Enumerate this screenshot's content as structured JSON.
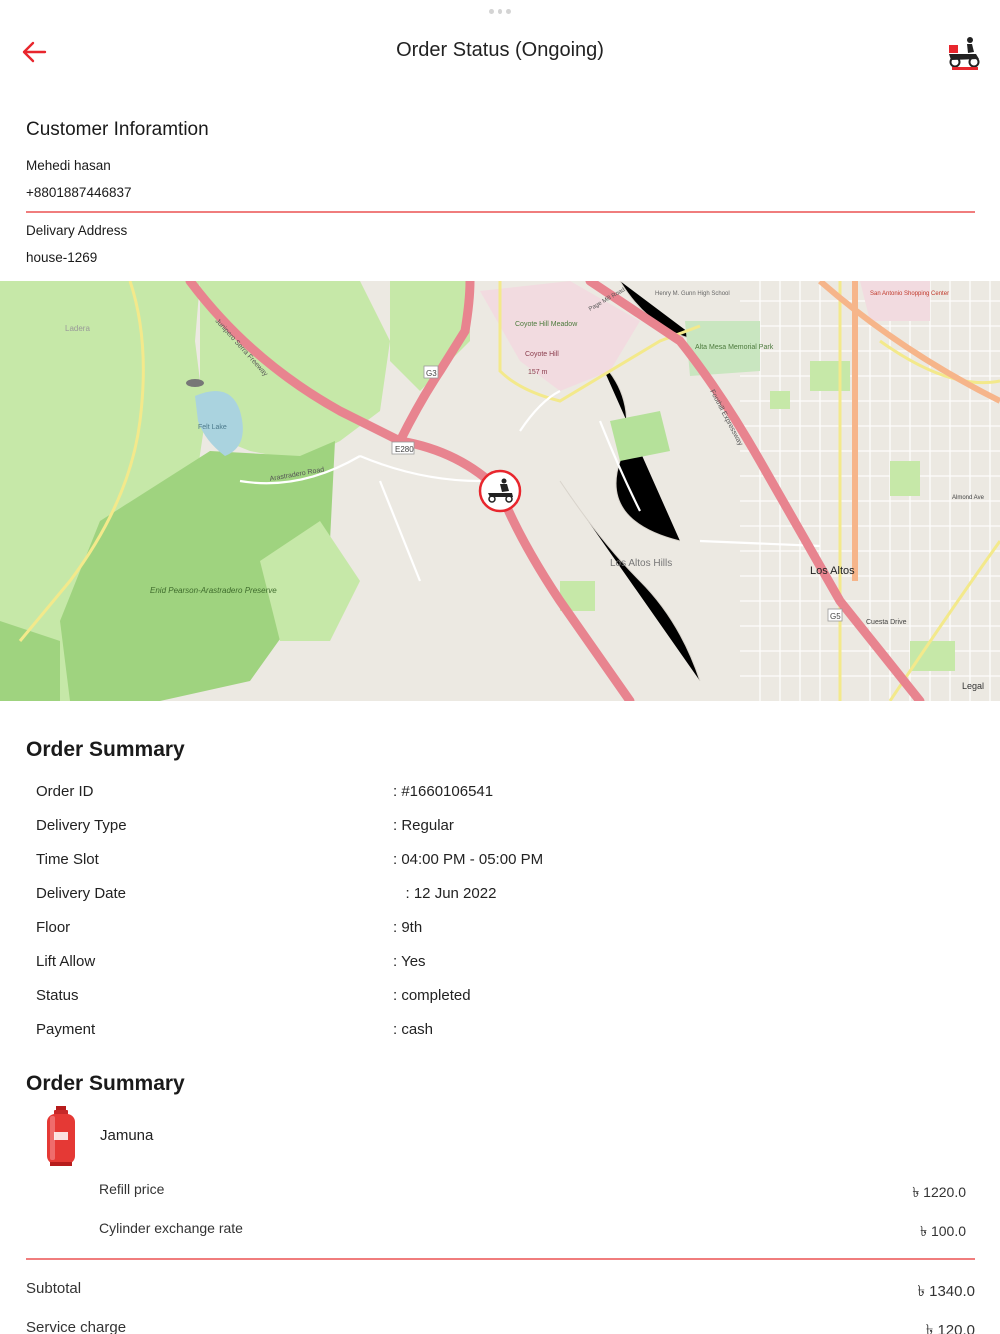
{
  "header": {
    "title": "Order Status (Ongoing)",
    "back_icon": "arrow-left-icon",
    "logo_icon": "delivery-scooter-logo-icon"
  },
  "customer": {
    "section_title": "Customer Inforamtion",
    "name": "Mehedi hasan",
    "phone": "+8801887446837",
    "address_label": "Delivary Address",
    "address": "house-1269"
  },
  "map": {
    "labels": {
      "coyote_hill_meadow": "Coyote Hill Meadow",
      "coyote_hill": "Coyote Hill",
      "coyote_hill_elev": "157 m",
      "los_altos_hills": "Los Altos Hills",
      "los_altos": "Los Altos",
      "enid_pearson": "Enid Pearson-Arastradero Preserve",
      "felt_lake": "Felt Lake",
      "ladera": "Ladera",
      "alta_mesa": "Alta Mesa Memorial Park",
      "e280": "E280",
      "g3": "G3",
      "g5": "G5",
      "junipero": "Junipero Serra Freeway",
      "arastradero": "Arastradero Road",
      "foothill": "Foothill Expressway",
      "legal": "Legal",
      "cuesta": "Cuesta Drive",
      "almond": "Almond Ave",
      "san_antonio": "San Antonio Shopping Center",
      "gunn": "Henry M. Gunn High School",
      "page_mill": "Page Mill Road"
    },
    "marker_icon": "delivery-rider-marker-icon"
  },
  "order_summary": {
    "title": "Order Summary",
    "rows": [
      {
        "key": "Order ID",
        "value": ": #1660106541"
      },
      {
        "key": "Delivery Type",
        "value": ": Regular"
      },
      {
        "key": "Time Slot",
        "value": ": 04:00 PM - 05:00 PM"
      },
      {
        "key": "Delivery Date",
        "value": "   : 12 Jun 2022"
      },
      {
        "key": "Floor",
        "value": ": 9th"
      },
      {
        "key": "Lift Allow",
        "value": ": Yes"
      },
      {
        "key": "Status",
        "value": ": completed"
      },
      {
        "key": "Payment",
        "value": ": cash"
      }
    ]
  },
  "items_summary": {
    "title": "Order Summary",
    "product_name": "Jamuna",
    "product_icon": "gas-cylinder-icon",
    "refill_label": "Refill price",
    "refill_value": "৳ 1220.0",
    "exchange_label": "Cylinder exchange rate",
    "exchange_value": "৳ 100.0"
  },
  "totals": {
    "subtotal_label": "Subtotal",
    "subtotal_value": "৳ 1340.0",
    "service_label": "Service charge",
    "service_value": "৳ 120.0"
  },
  "colors": {
    "accent": "#e8262d",
    "divider": "#f07d7d",
    "park": "#c6e8a8",
    "forest": "#9fd37f",
    "freeway": "#e8848f",
    "water": "#aad3df"
  }
}
